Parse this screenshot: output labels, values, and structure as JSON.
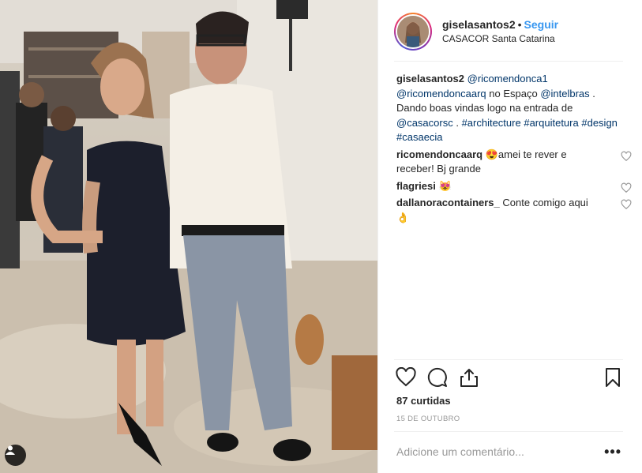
{
  "post": {
    "photo_alt": "",
    "header": {
      "username": "giselasantos2",
      "separator": "•",
      "follow_label": "Seguir",
      "location": "CASACOR Santa Catarina"
    },
    "caption": {
      "user": "giselasantos2",
      "mention1": "@ricomendonca1",
      "mention2": "@ricomendoncaarq",
      "text1": " no Espaço ",
      "mention3": "@intelbras",
      "text2": " . Dando boas vindas logo na entrada de ",
      "mention4": "@casacorsc",
      "text3": " . ",
      "tag1": "#architecture",
      "tag2": "#arquitetura",
      "tag3": "#design",
      "tag4": "#casaecia"
    },
    "comments": [
      {
        "user": "ricomendoncaarq",
        "text": " 😍amei te rever e receber! Bj grande"
      },
      {
        "user": "flagriesi",
        "text": " 😻"
      },
      {
        "user": "dallanoracontainers_",
        "text": " Conte comigo aqui 👌"
      }
    ],
    "likes_label": "87 curtidas",
    "date": "15 DE OUTUBRO",
    "add_comment_placeholder": "Adicione um comentário...",
    "more_label": "•••",
    "icons": {
      "like": "heart-icon",
      "comment": "comment-icon",
      "share": "share-icon",
      "save": "bookmark-icon",
      "tag": "user-tag-icon"
    },
    "colors": {
      "link": "#003569",
      "follow": "#3897f0",
      "muted": "#999999",
      "text": "#262626"
    }
  }
}
